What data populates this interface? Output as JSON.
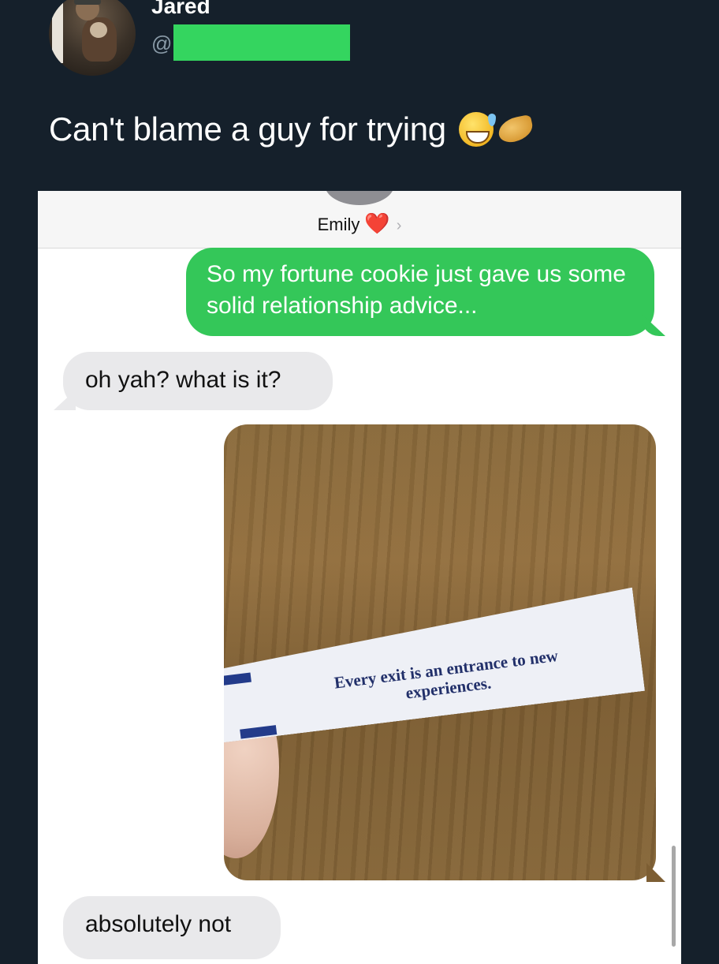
{
  "tweet": {
    "author_name": "Jared",
    "handle_prefix": "@",
    "text": "Can't blame a guy for trying",
    "emoji_icons": [
      "grinning-sweat-icon",
      "fortune-cookie-icon"
    ],
    "redaction_color": "#34d55f"
  },
  "conversation": {
    "contact_name": "Emily",
    "heart": "❤️",
    "chevron": "›",
    "messages": [
      {
        "type": "sent",
        "text": "So my fortune cookie just gave us some solid relationship advice..."
      },
      {
        "type": "received",
        "text": "oh yah? what is it?"
      },
      {
        "type": "sent-photo",
        "fortune_text": "Every exit is an entrance to new experiences."
      },
      {
        "type": "received",
        "text": "absolutely not"
      }
    ]
  },
  "colors": {
    "background": "#15202b",
    "sent_bubble": "#34c759",
    "received_bubble": "#e9e9eb"
  }
}
